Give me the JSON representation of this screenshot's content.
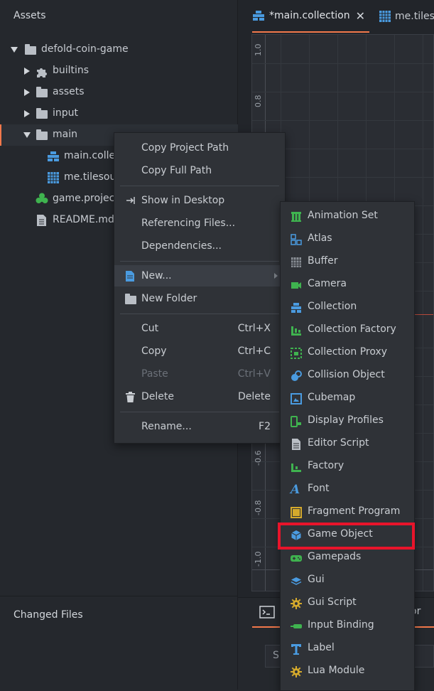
{
  "assets_panel": {
    "title": "Assets",
    "tree": [
      {
        "label": "defold-coin-game"
      },
      {
        "label": "builtins"
      },
      {
        "label": "assets"
      },
      {
        "label": "input"
      },
      {
        "label": "main"
      },
      {
        "label": "main.collection"
      },
      {
        "label": "me.tilesource"
      },
      {
        "label": "game.project"
      },
      {
        "label": "README.md"
      }
    ]
  },
  "changed_files": {
    "title": "Changed Files"
  },
  "editor": {
    "tabs": [
      {
        "label": "*main.collection"
      },
      {
        "label": "me.tilesource"
      }
    ],
    "axis_labels": [
      "1.0",
      "0.8",
      "-0.6",
      "-0.8",
      "-1.0"
    ],
    "bottom_partial_text": "or",
    "bottom_input_partial": "S"
  },
  "context_menu": {
    "items": [
      {
        "label": "Copy Project Path",
        "shortcut": ""
      },
      {
        "label": "Copy Full Path",
        "shortcut": ""
      },
      {
        "label": "Show in Desktop",
        "shortcut": ""
      },
      {
        "label": "Referencing Files...",
        "shortcut": ""
      },
      {
        "label": "Dependencies...",
        "shortcut": ""
      },
      {
        "label": "New...",
        "shortcut": ""
      },
      {
        "label": "New Folder",
        "shortcut": ""
      },
      {
        "label": "Cut",
        "shortcut": "Ctrl+X"
      },
      {
        "label": "Copy",
        "shortcut": "Ctrl+C"
      },
      {
        "label": "Paste",
        "shortcut": "Ctrl+V"
      },
      {
        "label": "Delete",
        "shortcut": "Delete"
      },
      {
        "label": "Rename...",
        "shortcut": "F2"
      }
    ]
  },
  "new_submenu": {
    "items": [
      {
        "label": "Animation Set",
        "icon": "animation-set-icon"
      },
      {
        "label": "Atlas",
        "icon": "atlas-icon"
      },
      {
        "label": "Buffer",
        "icon": "buffer-icon"
      },
      {
        "label": "Camera",
        "icon": "camera-icon"
      },
      {
        "label": "Collection",
        "icon": "collection-icon"
      },
      {
        "label": "Collection Factory",
        "icon": "collection-factory-icon"
      },
      {
        "label": "Collection Proxy",
        "icon": "collection-proxy-icon"
      },
      {
        "label": "Collision Object",
        "icon": "collision-object-icon"
      },
      {
        "label": "Cubemap",
        "icon": "cubemap-icon"
      },
      {
        "label": "Display Profiles",
        "icon": "display-profiles-icon"
      },
      {
        "label": "Editor Script",
        "icon": "editor-script-icon"
      },
      {
        "label": "Factory",
        "icon": "factory-icon"
      },
      {
        "label": "Font",
        "icon": "font-icon"
      },
      {
        "label": "Fragment Program",
        "icon": "fragment-program-icon"
      },
      {
        "label": "Game Object",
        "icon": "game-object-icon"
      },
      {
        "label": "Gamepads",
        "icon": "gamepads-icon"
      },
      {
        "label": "Gui",
        "icon": "gui-icon"
      },
      {
        "label": "Gui Script",
        "icon": "gui-script-icon"
      },
      {
        "label": "Input Binding",
        "icon": "input-binding-icon"
      },
      {
        "label": "Label",
        "icon": "label-icon"
      },
      {
        "label": "Lua Module",
        "icon": "lua-module-icon"
      }
    ]
  },
  "colors": {
    "accent": "#f2784b",
    "highlight_box": "#e8142b",
    "panel_bg": "#25282d",
    "menu_bg": "#2f3237"
  }
}
